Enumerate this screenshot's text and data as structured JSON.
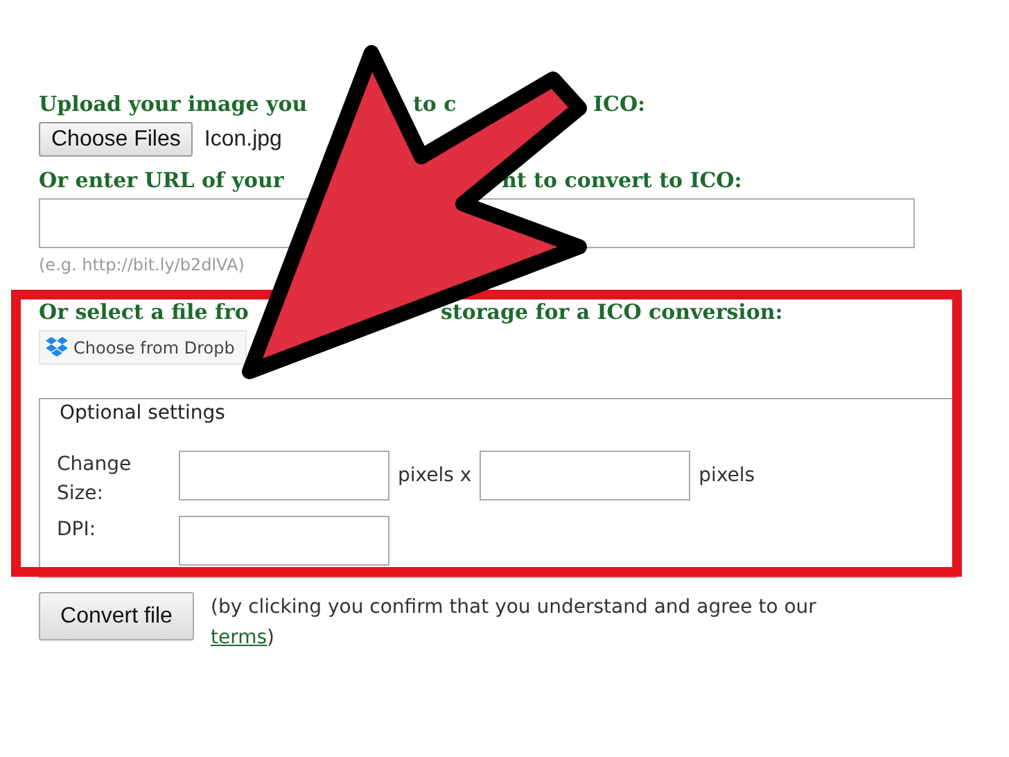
{
  "upload": {
    "heading_parts": [
      "Upload your image you",
      "to c",
      "ICO:"
    ],
    "button": "Choose Files",
    "file_name": "Icon.jpg"
  },
  "url": {
    "heading_parts": [
      "Or enter URL of your",
      "nt to convert to ICO:"
    ],
    "hint": "(e.g. http://bit.ly/b2dlVA)"
  },
  "cloud": {
    "heading_parts": [
      "Or select a file fro",
      "storage for a ICO conversion:"
    ],
    "button": "Choose from Dropb"
  },
  "settings": {
    "legend": "Optional settings",
    "size_label": "Change Size:",
    "unit_x": "pixels x",
    "unit": "pixels",
    "dpi_label": "DPI:"
  },
  "convert": {
    "button": "Convert file",
    "note_before": "(by clicking you confirm that you understand and agree to our",
    "link": "terms",
    "note_after": ")"
  }
}
